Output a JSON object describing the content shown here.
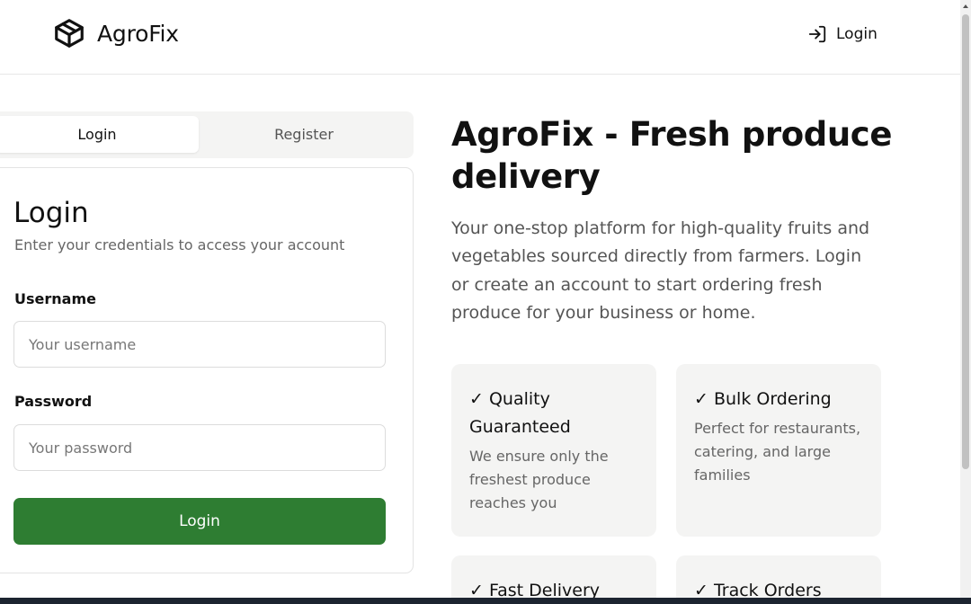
{
  "header": {
    "brand_icon": "package-icon",
    "brand_name": "AgroFix",
    "login_icon": "log-in-icon",
    "login_label": "Login"
  },
  "tabs": {
    "login_label": "Login",
    "register_label": "Register"
  },
  "login_card": {
    "title": "Login",
    "subtitle": "Enter your credentials to access your account",
    "username_label": "Username",
    "username_placeholder": "Your username",
    "username_value": "",
    "password_label": "Password",
    "password_placeholder": "Your password",
    "password_value": "",
    "submit_label": "Login"
  },
  "hero": {
    "title": "AgroFix - Fresh produce delivery",
    "description": "Your one-stop platform for high-quality fruits and vegetables sourced directly from farmers. Login or create an account to start ordering fresh produce for your business or home."
  },
  "features": [
    {
      "title": "✓ Quality Guaranteed",
      "description": "We ensure only the freshest produce reaches you"
    },
    {
      "title": "✓ Bulk Ordering",
      "description": "Perfect for restaurants, catering, and large families"
    },
    {
      "title": "✓ Fast Delivery",
      "description": ""
    },
    {
      "title": "✓ Track Orders",
      "description": ""
    }
  ],
  "colors": {
    "primary": "#2e7d32",
    "muted_bg": "#f4f4f3",
    "border": "#e3e3e3",
    "text": "#111111",
    "muted_text": "#666666"
  }
}
